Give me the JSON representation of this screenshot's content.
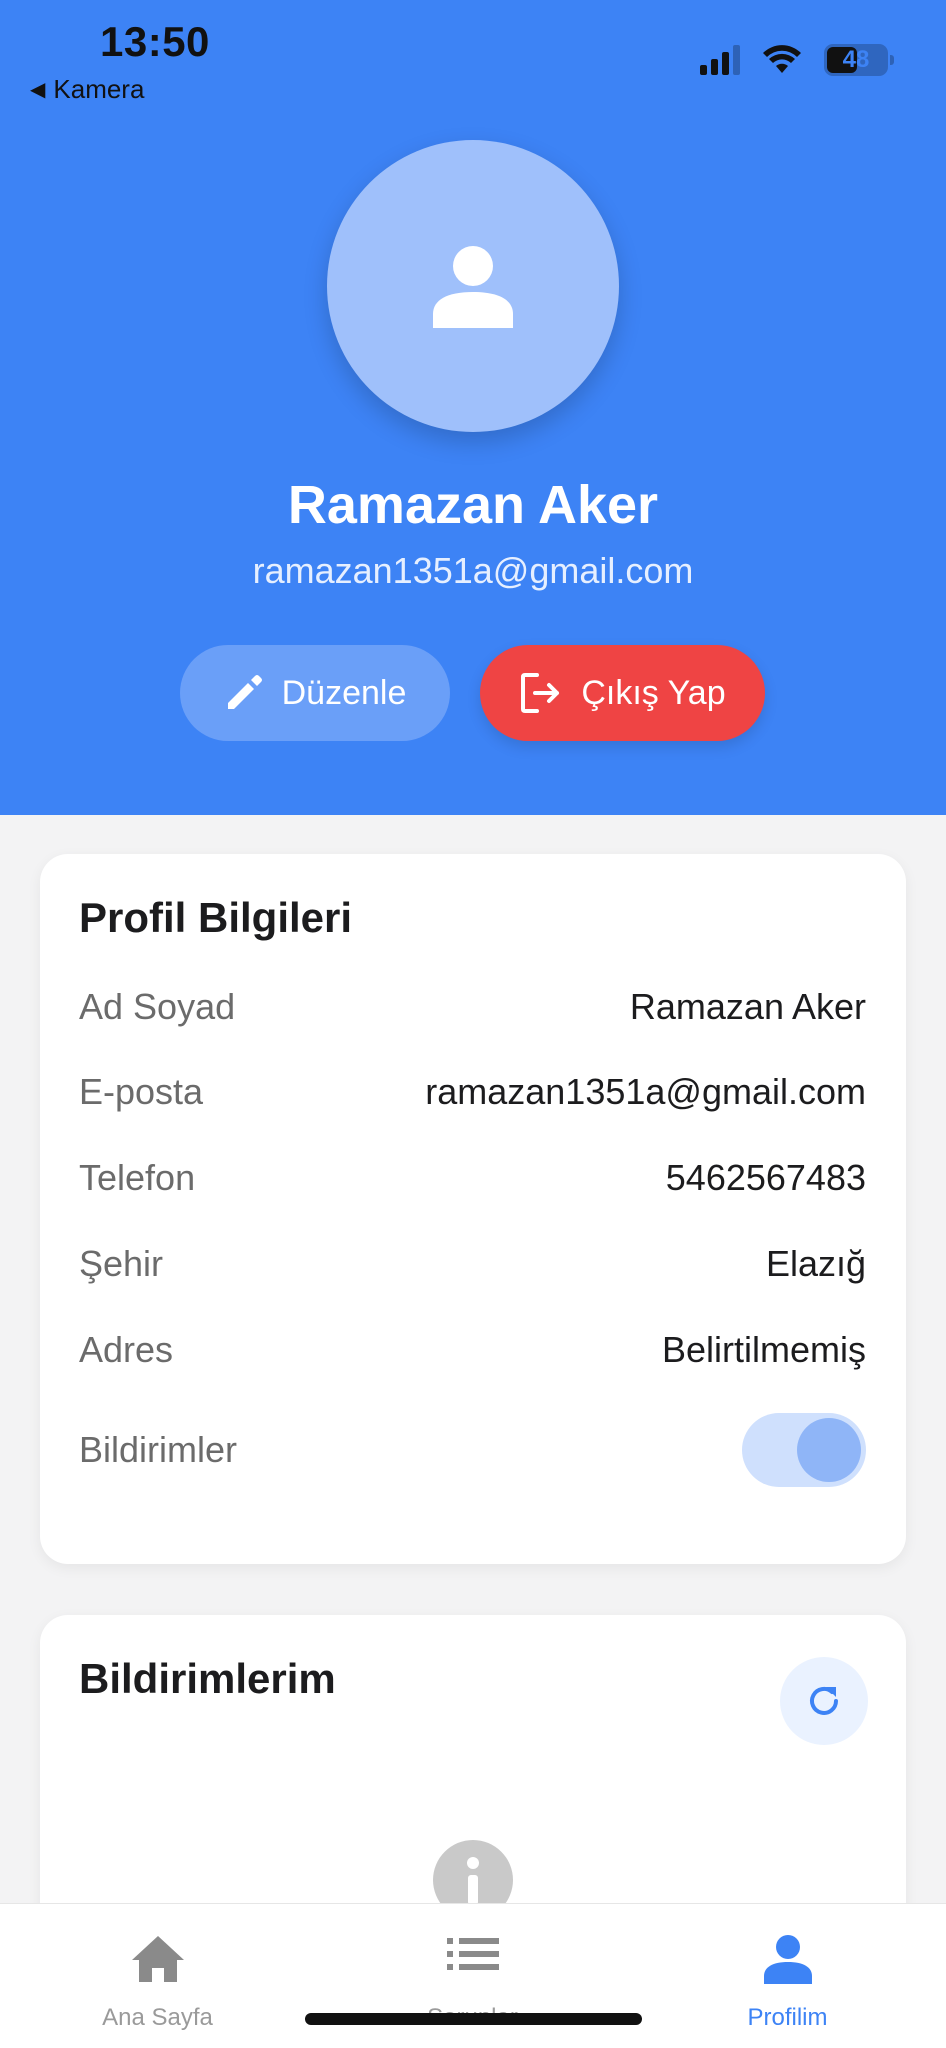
{
  "status_bar": {
    "time": "13:50",
    "back_app": "Kamera",
    "battery": "48"
  },
  "header": {
    "name": "Ramazan Aker",
    "email": "ramazan1351a@gmail.com",
    "edit_label": "Düzenle",
    "logout_label": "Çıkış Yap",
    "background_color": "#3d83f5",
    "logout_color": "#ef4444"
  },
  "profile_card": {
    "title": "Profil Bilgileri",
    "rows": [
      {
        "label": "Ad Soyad",
        "value": "Ramazan Aker"
      },
      {
        "label": "E-posta",
        "value": "ramazan1351a@gmail.com"
      },
      {
        "label": "Telefon",
        "value": "5462567483"
      },
      {
        "label": "Şehir",
        "value": "Elazığ"
      },
      {
        "label": "Adres",
        "value": "Belirtilmemiş"
      }
    ],
    "notifications_label": "Bildirimler",
    "notifications_enabled": true
  },
  "notifications_card": {
    "title": "Bildirimlerim"
  },
  "bottom_nav": {
    "items": [
      {
        "label": "Ana Sayfa",
        "icon": "home-icon"
      },
      {
        "label": "Sorunlar",
        "icon": "list-icon"
      },
      {
        "label": "Profilim",
        "icon": "person-icon",
        "active": true
      }
    ]
  }
}
